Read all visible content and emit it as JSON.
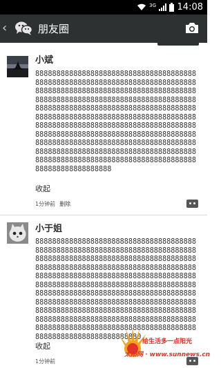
{
  "status_bar": {
    "network": "3G",
    "time": "14:08",
    "icons": [
      "wifi-icon",
      "signal-icon",
      "battery-icon"
    ]
  },
  "title_bar": {
    "back_icon": "chevron-left-icon",
    "logo_icon": "wechat-logo-icon",
    "title": "朋友圈",
    "camera_icon": "camera-icon"
  },
  "posts": [
    {
      "author": "小斌",
      "content": "8888888888888888888888888888888888888888888888888888888888888888888888888888888888888888888888888888888888888888888888888888888888888888888888888888888888888888888888888888888888888888888888888888888888888888888888888888888888888888888888888888888888888888888888888888888888888888888888888888888888888888888888888888888888888888888888888888888888888888888888888888888888888888888888888888888888888888888888888888888888888888888888888888",
      "collapse_label": "收起",
      "time": "1分钟前",
      "delete_label": "删除"
    },
    {
      "author": "小于姐",
      "content": "88888888888888888888888888888888888888888888888888888888888888888888888888888888888888888888888888888888888888888888888888888888888888888888888888888888888888888888888888888888888888888888888888888888888888888888888888888888888888888888888888888888888888888888888888888888888888888888888888888888888888888888888888888888888888888888888888888888888888888888888888888888888888888888888888888888888888888888888888888888888888888888888888888888880",
      "collapse_label": "收起",
      "time": "1分钟前"
    }
  ],
  "watermark": {
    "slogan": "给生活多一点阳光",
    "brand": "太阳网 · www.sunnews.cn"
  },
  "colors": {
    "title_bar": "#2e3132",
    "status_bar": "#000000",
    "watermark": "#e2322a"
  }
}
